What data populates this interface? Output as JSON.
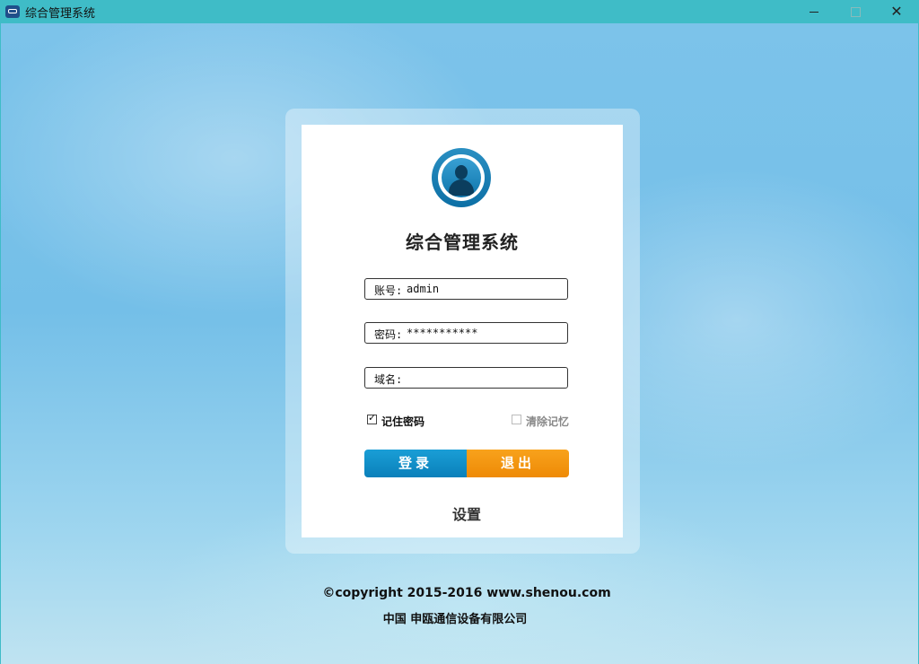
{
  "window": {
    "title": "综合管理系统",
    "minimize": "—",
    "maximize": "□",
    "close": "✕"
  },
  "login": {
    "title": "综合管理系统",
    "account_label": "账号:",
    "account_value": "admin",
    "password_label": "密码:",
    "password_value": "***********",
    "domain_label": "域名:",
    "domain_value": "",
    "remember_password": "记住密码",
    "remember_checked": true,
    "clear_memory": "清除记忆",
    "clear_checked": false,
    "login_button": "登录",
    "exit_button": "退出",
    "settings": "设置"
  },
  "footer": {
    "copyright": "©copyright 2015-2016 www.shenou.com",
    "company": "中国 申瓯通信设备有限公司"
  },
  "colors": {
    "titlebar": "#3fbcc7",
    "login_button": "#0a80ba",
    "exit_button": "#ee8a06"
  }
}
